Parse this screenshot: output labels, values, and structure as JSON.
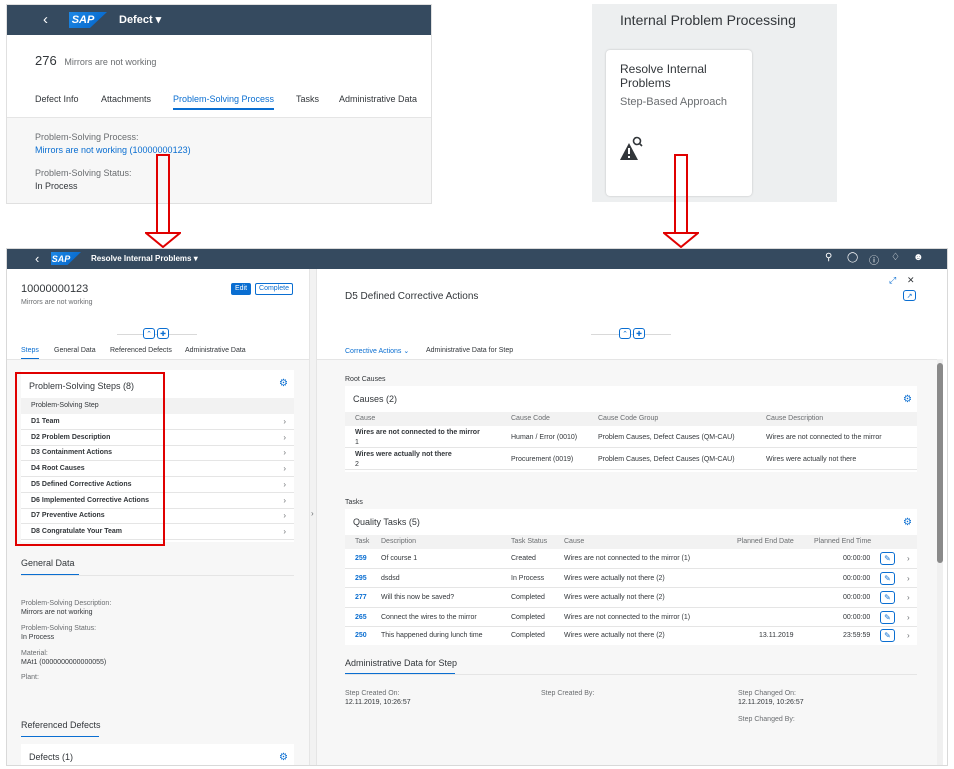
{
  "defect_panel": {
    "shell_title": "Defect",
    "header_number": "276",
    "header_desc": "Mirrors are not working",
    "tabs": [
      "Defect Info",
      "Attachments",
      "Problem-Solving Process",
      "Tasks",
      "Administrative Data"
    ],
    "ps_process_label": "Problem-Solving Process:",
    "ps_process_value": "Mirrors are not working (10000000123)",
    "ps_status_label": "Problem-Solving Status:",
    "ps_status_value": "In Process"
  },
  "tile_panel": {
    "group_title": "Internal Problem Processing",
    "tile_title": "Resolve Internal Problems",
    "tile_subtitle": "Step-Based Approach"
  },
  "main_app": {
    "shell_title": "Resolve Internal Problems",
    "left": {
      "object_id": "10000000123",
      "object_desc": "Mirrors are not working",
      "edit_label": "Edit",
      "complete_label": "Complete",
      "tabs": [
        "Steps",
        "General Data",
        "Referenced Defects",
        "Administrative Data"
      ],
      "steps_title": "Problem-Solving Steps (8)",
      "steps_col": "Problem-Solving Step",
      "steps": [
        "D1 Team",
        "D2 Problem Description",
        "D3 Containment Actions",
        "D4 Root Causes",
        "D5 Defined Corrective Actions",
        "D6 Implemented Corrective Actions",
        "D7 Preventive Actions",
        "D8 Congratulate Your Team"
      ],
      "general_data_title": "General Data",
      "fields": [
        {
          "label": "Problem-Solving Description:",
          "value": "Mirrors are not working"
        },
        {
          "label": "Problem-Solving Status:",
          "value": "In Process"
        },
        {
          "label": "Material:",
          "value": "MAt1 (0000000000000055)"
        },
        {
          "label": "Plant:",
          "value": ""
        }
      ],
      "ref_defects_title": "Referenced Defects",
      "defects_title": "Defects (1)"
    },
    "right": {
      "title": "D5 Defined Corrective Actions",
      "tabs": [
        "Corrective Actions",
        "Administrative Data for Step"
      ],
      "root_causes_label": "Root Causes",
      "causes_title": "Causes (2)",
      "causes_headers": [
        "Cause",
        "Cause Code",
        "Cause Code Group",
        "Cause Description"
      ],
      "causes": [
        {
          "cause": "Wires are not connected to the mirror",
          "num": "1",
          "code": "Human / Error (0010)",
          "group": "Problem Causes, Defect Causes (QM-CAU)",
          "desc": "Wires are not connected to the mirror"
        },
        {
          "cause": "Wires were actually not there",
          "num": "2",
          "code": "Procurement (0019)",
          "group": "Problem Causes, Defect Causes (QM-CAU)",
          "desc": "Wires were actually not there"
        }
      ],
      "tasks_label": "Tasks",
      "qtasks_title": "Quality Tasks (5)",
      "task_headers": [
        "Task",
        "Description",
        "Task Status",
        "Cause",
        "Planned End Date",
        "Planned End Time"
      ],
      "tasks": [
        {
          "task": "259",
          "desc": "Of course 1",
          "status": "Created",
          "cause": "Wires are not connected to the mirror (1)",
          "date": "",
          "time": "00:00:00"
        },
        {
          "task": "295",
          "desc": "dsdsd",
          "status": "In Process",
          "cause": "Wires were actually not there (2)",
          "date": "",
          "time": "00:00:00"
        },
        {
          "task": "277",
          "desc": "Will this now be saved?",
          "status": "Completed",
          "cause": "Wires were actually not there (2)",
          "date": "",
          "time": "00:00:00"
        },
        {
          "task": "265",
          "desc": "Connect the wires to the mirror",
          "status": "Completed",
          "cause": "Wires are not connected to the mirror (1)",
          "date": "",
          "time": "00:00:00"
        },
        {
          "task": "250",
          "desc": "This happened during lunch time",
          "status": "Completed",
          "cause": "Wires were actually not there (2)",
          "date": "13.11.2019",
          "time": "23:59:59"
        }
      ],
      "admin_title": "Administrative Data for Step",
      "created_on_label": "Step Created On:",
      "created_on_value": "12.11.2019, 10:26:57",
      "created_by_label": "Step Created By:",
      "changed_on_label": "Step Changed On:",
      "changed_on_value": "12.11.2019, 10:26:57",
      "changed_by_label": "Step Changed By:"
    }
  },
  "colors": {
    "shell": "#354a5f",
    "accent": "#0a6ed1",
    "highlight": "#e00000"
  },
  "icons": [
    "back-icon",
    "search-icon",
    "settings-icon",
    "help-icon",
    "bell-icon",
    "user-icon",
    "expand-icon",
    "close-icon",
    "export-icon",
    "collapse-icon",
    "pin-icon",
    "edit-icon",
    "chevron-right-icon",
    "warning-search-icon"
  ]
}
